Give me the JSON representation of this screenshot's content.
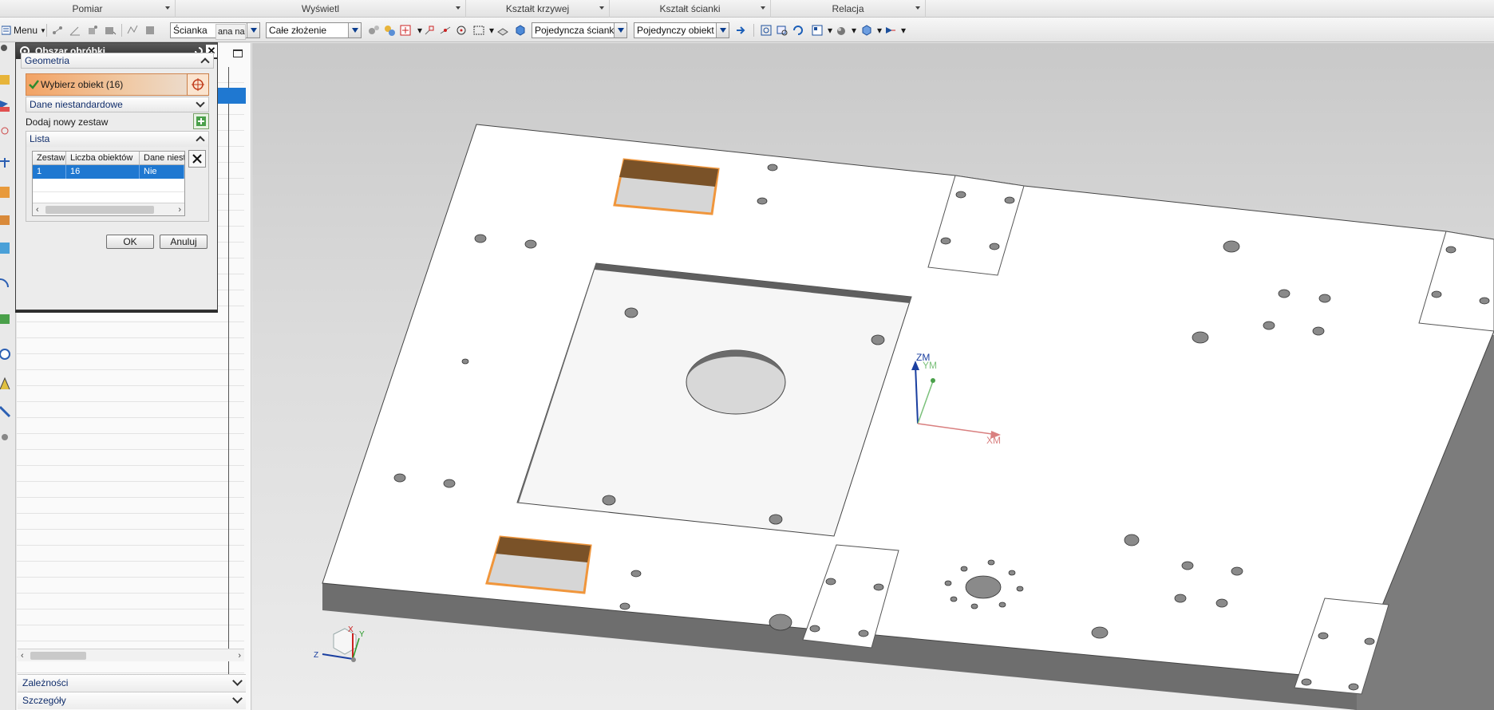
{
  "ribbon_groups": [
    {
      "label": "Pomiar"
    },
    {
      "label": "Wyświetl"
    },
    {
      "label": "Kształt krzywej"
    },
    {
      "label": "Kształt ścianki"
    },
    {
      "label": "Relacja"
    }
  ],
  "toolbar": {
    "menu_label": "Menu",
    "filter_combo": "Ścianka",
    "scope_combo": "Całe złożenie",
    "face_rule_combo": "Pojedyncza ścianka",
    "object_rule_combo": "Pojedynczy obiekt"
  },
  "navigator": {
    "column_header": "ana nar",
    "sections": [
      "Zależności",
      "Szczegóły"
    ]
  },
  "dialog": {
    "title": "Obszar obróbki",
    "group_geometry": "Geometria",
    "select_object": "Wybierz obiekt (16)",
    "custom_data": "Dane niestandardowe",
    "add_new_set": "Dodaj nowy zestaw",
    "group_list": "Lista",
    "table": {
      "headers": [
        "Zestaw",
        "Liczba obiektów",
        "Dane niesta"
      ],
      "rows": [
        [
          "1",
          "16",
          "Nie"
        ]
      ]
    },
    "ok_label": "OK",
    "cancel_label": "Anuluj"
  },
  "viewport": {
    "axis_labels": {
      "zm": "ZM",
      "ym": "YM",
      "xm": "XM"
    },
    "triad_labels": {
      "x": "X",
      "y": "Y",
      "z": "Z"
    }
  },
  "colors": {
    "selection_blue": "#1f78d1",
    "highlight_orange": "#f0963c",
    "axis_z": "#1a3fa0",
    "axis_y": "#7bc17b",
    "axis_x": "#d98080"
  }
}
